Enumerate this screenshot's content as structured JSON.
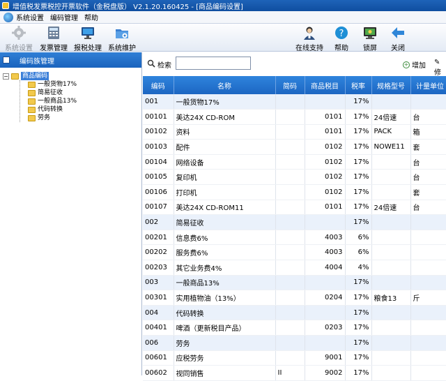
{
  "window": {
    "title": "增值税发票税控开票软件（金税盘版） V2.1.20.160425 - [商品编码设置]"
  },
  "menu": {
    "items": [
      "系统设置",
      "编码管理",
      "帮助"
    ]
  },
  "toolbar": {
    "left": [
      {
        "label": "系统设置",
        "icon": "gear-icon",
        "disabled": true
      },
      {
        "label": "发票管理",
        "icon": "calculator-icon",
        "disabled": false
      },
      {
        "label": "报税处理",
        "icon": "monitor-icon",
        "disabled": false
      },
      {
        "label": "系统维护",
        "icon": "folder-gear-icon",
        "disabled": false
      }
    ],
    "right": [
      {
        "label": "在线支持",
        "icon": "support-person-icon"
      },
      {
        "label": "帮助",
        "icon": "help-icon"
      },
      {
        "label": "锁屏",
        "icon": "lock-screen-icon"
      },
      {
        "label": "关闭",
        "icon": "back-arrow-icon"
      }
    ]
  },
  "sidebar": {
    "title": "编码族管理",
    "root": "商品编码",
    "children": [
      "一般货物17%",
      "简易征收",
      "一般商品13%",
      "代码转换",
      "劳务"
    ]
  },
  "search": {
    "label": "检索",
    "value": "",
    "placeholder": ""
  },
  "actions": {
    "add": "增加",
    "edit": "修"
  },
  "table": {
    "columns": [
      "编码",
      "名称",
      "简码",
      "商品税目",
      "税率",
      "规格型号",
      "计量单位"
    ],
    "rows": [
      {
        "code": "001",
        "name": "一般货物17%",
        "short": "",
        "tax_item": "",
        "rate": "17%",
        "spec": "",
        "unit": "",
        "group": true
      },
      {
        "code": "00101",
        "name": "美达24X CD-ROM",
        "short": "",
        "tax_item": "0101",
        "rate": "17%",
        "spec": "24倍速",
        "unit": "台",
        "group": false
      },
      {
        "code": "00102",
        "name": "资料",
        "short": "",
        "tax_item": "0101",
        "rate": "17%",
        "spec": "PACK",
        "unit": "箱",
        "group": false
      },
      {
        "code": "00103",
        "name": "配件",
        "short": "",
        "tax_item": "0102",
        "rate": "17%",
        "spec": "NOWE11",
        "unit": "套",
        "group": false
      },
      {
        "code": "00104",
        "name": "网络设备",
        "short": "",
        "tax_item": "0102",
        "rate": "17%",
        "spec": "",
        "unit": "台",
        "group": false
      },
      {
        "code": "00105",
        "name": "复印机",
        "short": "",
        "tax_item": "0102",
        "rate": "17%",
        "spec": "",
        "unit": "台",
        "group": false
      },
      {
        "code": "00106",
        "name": "打印机",
        "short": "",
        "tax_item": "0102",
        "rate": "17%",
        "spec": "",
        "unit": "套",
        "group": false
      },
      {
        "code": "00107",
        "name": "美达24X CD-ROM11",
        "short": "",
        "tax_item": "0101",
        "rate": "17%",
        "spec": "24倍速",
        "unit": "台",
        "group": false
      },
      {
        "code": "002",
        "name": "简易征收",
        "short": "",
        "tax_item": "",
        "rate": "17%",
        "spec": "",
        "unit": "",
        "group": true
      },
      {
        "code": "00201",
        "name": "信息费6%",
        "short": "",
        "tax_item": "4003",
        "rate": "6%",
        "spec": "",
        "unit": "",
        "group": false
      },
      {
        "code": "00202",
        "name": "服务费6%",
        "short": "",
        "tax_item": "4003",
        "rate": "6%",
        "spec": "",
        "unit": "",
        "group": false
      },
      {
        "code": "00203",
        "name": "其它业务费4%",
        "short": "",
        "tax_item": "4004",
        "rate": "4%",
        "spec": "",
        "unit": "",
        "group": false
      },
      {
        "code": "003",
        "name": "一般商品13%",
        "short": "",
        "tax_item": "",
        "rate": "17%",
        "spec": "",
        "unit": "",
        "group": true
      },
      {
        "code": "00301",
        "name": "实用植物油（13%）",
        "short": "",
        "tax_item": "0204",
        "rate": "17%",
        "spec": "粮食13",
        "unit": "斤",
        "group": false
      },
      {
        "code": "004",
        "name": "代码转换",
        "short": "",
        "tax_item": "",
        "rate": "17%",
        "spec": "",
        "unit": "",
        "group": true
      },
      {
        "code": "00401",
        "name": "啤酒（更新税目产品）",
        "short": "",
        "tax_item": "0203",
        "rate": "17%",
        "spec": "",
        "unit": "",
        "group": false
      },
      {
        "code": "006",
        "name": "劳务",
        "short": "",
        "tax_item": "",
        "rate": "17%",
        "spec": "",
        "unit": "",
        "group": true
      },
      {
        "code": "00601",
        "name": "应税劳务",
        "short": "",
        "tax_item": "9001",
        "rate": "17%",
        "spec": "",
        "unit": "",
        "group": false
      },
      {
        "code": "00602",
        "name": "视同销售",
        "short": "II",
        "tax_item": "9002",
        "rate": "17%",
        "spec": "",
        "unit": "",
        "group": false
      }
    ]
  },
  "colors": {
    "header_blue": "#1c66c2",
    "group_row": "#eaf1fb",
    "selection": "#3b7fd8"
  }
}
